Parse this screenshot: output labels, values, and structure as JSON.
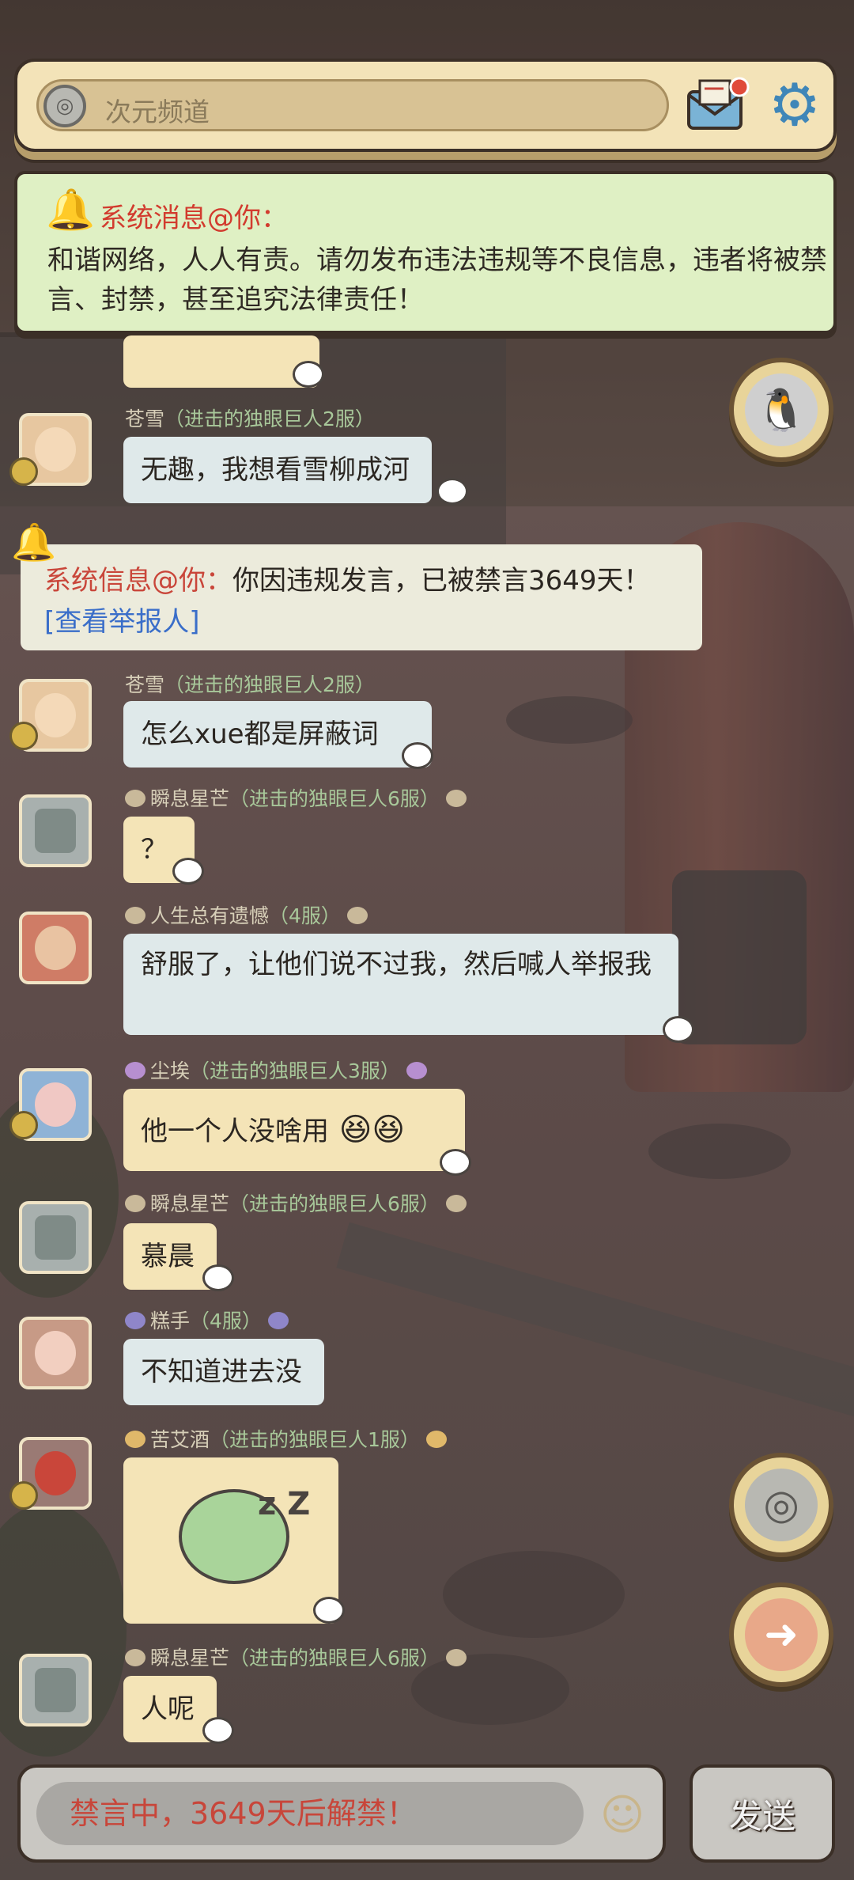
{
  "header": {
    "channel_label": "次元频道"
  },
  "notice": {
    "title": "系统消息@你：",
    "body": "和谐网络，人人有责。请勿发布违法违规等不良信息，违者将被禁言、封禁，甚至追究法律责任！"
  },
  "messages": [
    {
      "user": "苍雪",
      "server": "（进击的独眼巨人2服）",
      "text": "无趣，我想看雪柳成河"
    },
    {
      "user": "苍雪",
      "server": "（进击的独眼巨人2服）",
      "text": "怎么xue都是屏蔽词"
    },
    {
      "user": "瞬息星芒",
      "server": "（进击的独眼巨人6服）",
      "text": "？"
    },
    {
      "user": "人生总有遗憾",
      "server": "（4服）",
      "text": "舒服了，让他们说不过我，然后喊人举报我"
    },
    {
      "user": "尘埃",
      "server": "（进击的独眼巨人3服）",
      "text": "他一个人没啥用"
    },
    {
      "user": "瞬息星芒",
      "server": "（进击的独眼巨人6服）",
      "text": "慕晨"
    },
    {
      "user": "糕手",
      "server": "（4服）",
      "text": "不知道进去没"
    },
    {
      "user": "苦艾酒",
      "server": "（进击的独眼巨人1服）",
      "text": ""
    },
    {
      "user": "瞬息星芒",
      "server": "（进击的独眼巨人6服）",
      "text": "人呢"
    }
  ],
  "sysinfo": {
    "prefix": "系统信息@你：",
    "text": "你因违规发言，已被禁言3649天！",
    "link": "[查看举报人]"
  },
  "input": {
    "muted_text": "禁言中，3649天后解禁！",
    "send_label": "发送"
  },
  "icons": {
    "channel": "channel-swirl-icon",
    "mail": "mail-notification-icon",
    "settings": "gear-icon",
    "qq": "penguin-icon",
    "switch": "swirl-icon",
    "next": "arrow-right-icon",
    "emoji": "emoji-icon"
  },
  "colors": {
    "accent_red": "#d23b2e",
    "link_blue": "#3a6ec9",
    "bubble_blue": "#dfe9ea",
    "bubble_yellow": "#f4e4b7",
    "notice_green": "#dff0c4"
  }
}
